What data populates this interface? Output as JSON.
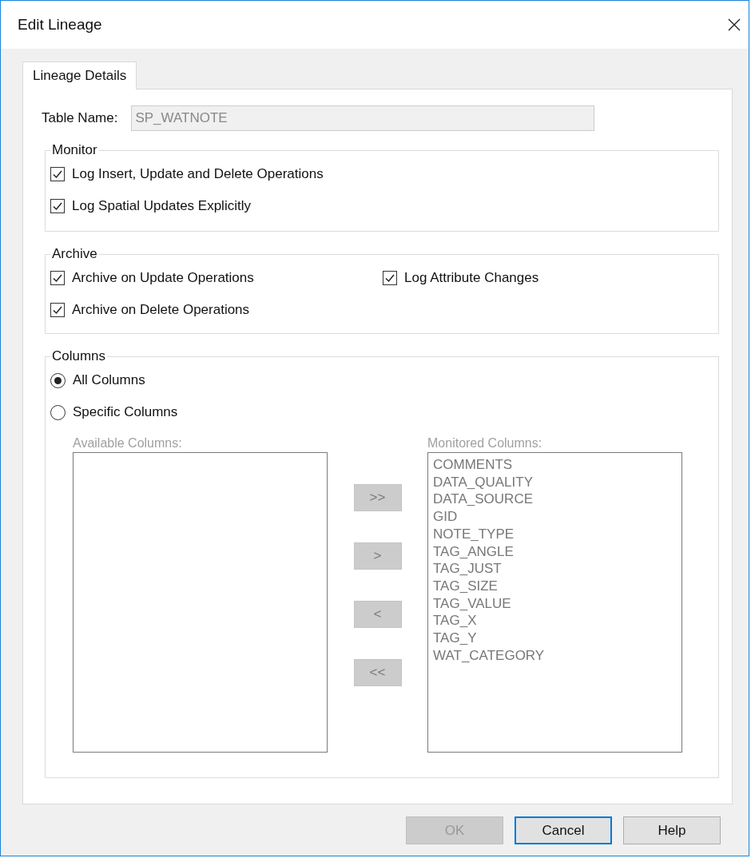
{
  "window": {
    "title": "Edit Lineage"
  },
  "tabs": [
    {
      "label": "Lineage Details",
      "selected": true
    }
  ],
  "table_name": {
    "label": "Table Name:",
    "value": "SP_WATNOTE",
    "disabled": true
  },
  "monitor": {
    "title": "Monitor",
    "options": [
      {
        "label": "Log Insert, Update and Delete Operations",
        "checked": true
      },
      {
        "label": "Log Spatial Updates Explicitly",
        "checked": true
      }
    ]
  },
  "archive": {
    "title": "Archive",
    "options": [
      {
        "label": "Archive on Update Operations",
        "checked": true
      },
      {
        "label": "Log Attribute Changes",
        "checked": true
      },
      {
        "label": "Archive on Delete Operations",
        "checked": true
      }
    ]
  },
  "columns": {
    "title": "Columns",
    "modes": [
      {
        "label": "All Columns",
        "selected": true
      },
      {
        "label": "Specific Columns",
        "selected": false
      }
    ],
    "available": {
      "label": "Available Columns:",
      "disabled": true
    },
    "transfer_buttons": [
      {
        "label": ">>",
        "disabled": true
      },
      {
        "label": ">",
        "disabled": true
      },
      {
        "label": "<",
        "disabled": true
      },
      {
        "label": "<<",
        "disabled": true
      }
    ],
    "monitored": {
      "label": "Monitored Columns:",
      "disabled": true,
      "items": [
        "COMMENTS",
        "DATA_QUALITY",
        "DATA_SOURCE",
        "GID",
        "NOTE_TYPE",
        "TAG_ANGLE",
        "TAG_JUST",
        "TAG_SIZE",
        "TAG_VALUE",
        "TAG_X",
        "TAG_Y",
        "WAT_CATEGORY"
      ]
    }
  },
  "buttons": [
    {
      "label": "OK",
      "disabled": true,
      "focused": false
    },
    {
      "label": "Cancel",
      "disabled": false,
      "focused": true
    },
    {
      "label": "Help",
      "disabled": false,
      "focused": false
    }
  ]
}
